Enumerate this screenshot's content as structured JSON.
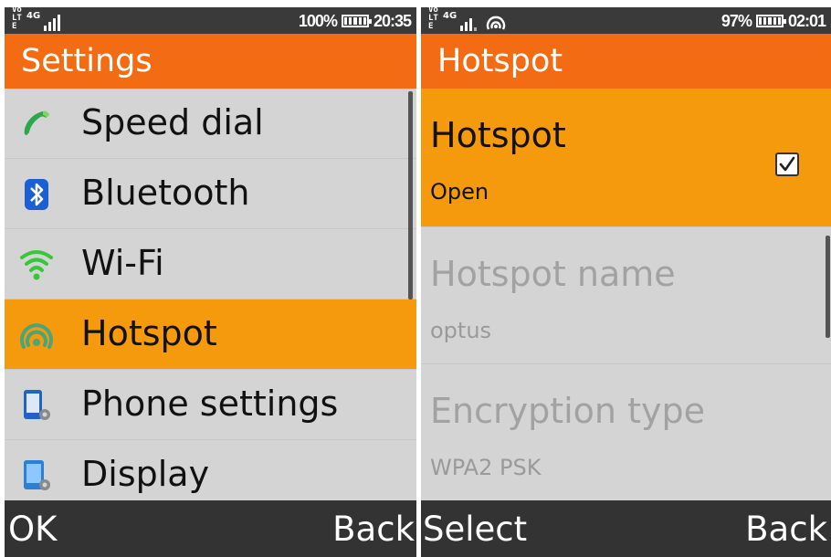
{
  "left_screen": {
    "status": {
      "volte": "Vo LTE",
      "network": "4G",
      "battery_text": "100%",
      "time": "20:35"
    },
    "title": "Settings",
    "menu": [
      {
        "label": "Speed dial",
        "icon": "phone-icon",
        "selected": false
      },
      {
        "label": "Bluetooth",
        "icon": "bluetooth-icon",
        "selected": false
      },
      {
        "label": "Wi-Fi",
        "icon": "wifi-icon",
        "selected": false
      },
      {
        "label": "Hotspot",
        "icon": "hotspot-icon",
        "selected": true
      },
      {
        "label": "Phone settings",
        "icon": "phone-settings-icon",
        "selected": false
      },
      {
        "label": "Display",
        "icon": "display-settings-icon",
        "selected": false
      }
    ],
    "softkeys": {
      "left": "OK",
      "right": "Back"
    }
  },
  "right_screen": {
    "status": {
      "volte": "Vo LTE",
      "network": "4G",
      "hotspot_indicator": "hotspot-icon",
      "battery_text": "97%",
      "time": "02:01"
    },
    "title": "Hotspot",
    "items": [
      {
        "title": "Hotspot",
        "value": "Open",
        "checked": true,
        "selected": true
      },
      {
        "title": "Hotspot name",
        "value": "optus",
        "selected": false
      },
      {
        "title": "Encryption type",
        "value": "WPA2 PSK",
        "selected": false
      }
    ],
    "softkeys": {
      "left": "Select",
      "right": "Back"
    }
  },
  "colors": {
    "title_orange": "#f36b12",
    "title_teal": "#1fc3c3",
    "selection": "#f59a0c",
    "list_background": "#d4d4d4",
    "status_bar": "#3a3a3a",
    "softkey_bar": "#333333"
  }
}
